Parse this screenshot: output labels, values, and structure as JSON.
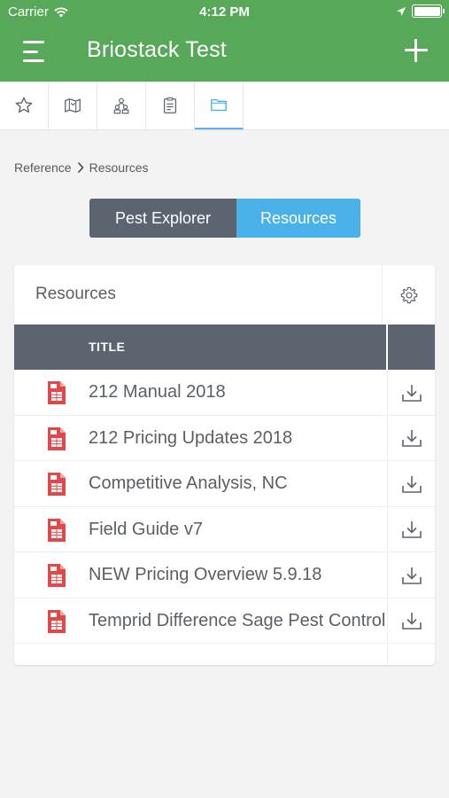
{
  "status_bar": {
    "carrier": "Carrier",
    "time": "4:12 PM"
  },
  "header": {
    "title": "Briostack Test"
  },
  "tabs": [
    {
      "icon": "star-icon",
      "active": false
    },
    {
      "icon": "map-icon",
      "active": false
    },
    {
      "icon": "people-icon",
      "active": false
    },
    {
      "icon": "clipboard-icon",
      "active": false
    },
    {
      "icon": "folder-icon",
      "active": true
    }
  ],
  "breadcrumb": {
    "parent": "Reference",
    "current": "Resources"
  },
  "segment": {
    "left_label": "Pest Explorer",
    "right_label": "Resources",
    "selected": "Resources"
  },
  "card": {
    "title": "Resources",
    "column_title": "TITLE",
    "rows": [
      {
        "title": "212 Manual 2018"
      },
      {
        "title": "212 Pricing Updates 2018"
      },
      {
        "title": "Competitive Analysis, NC"
      },
      {
        "title": "Field Guide v7"
      },
      {
        "title": "NEW Pricing Overview 5.9.18"
      },
      {
        "title": "Temprid Difference Sage Pest Control"
      }
    ]
  },
  "colors": {
    "header_green": "#58a85a",
    "accent_blue": "#4ab2e8",
    "dark_slate": "#5c6470",
    "pdf_red": "#e0484a"
  }
}
